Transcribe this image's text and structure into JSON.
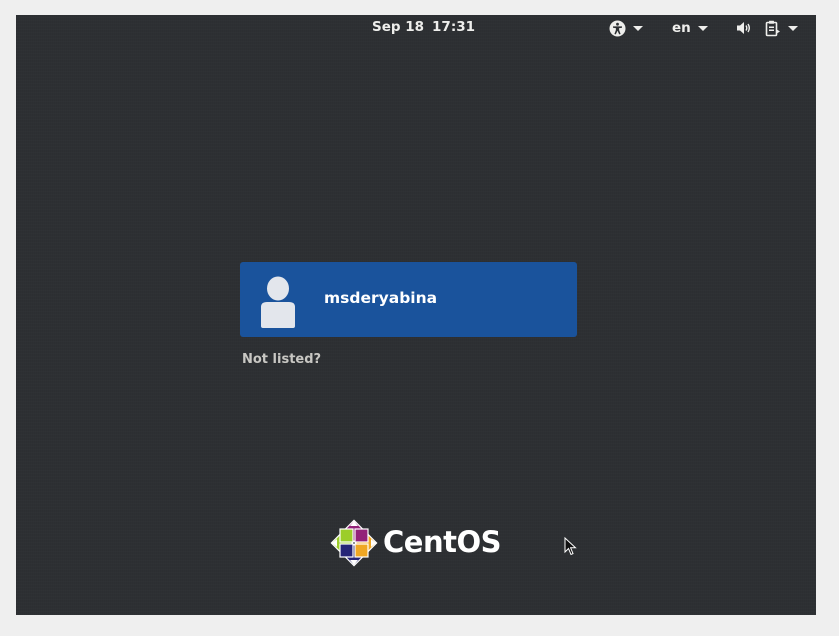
{
  "topbar": {
    "date": "Sep 18",
    "time": "17:31",
    "language": "en",
    "icons": {
      "accessibility": "accessibility-icon",
      "volume": "volume-icon",
      "power_menu": "clipboard-power-icon"
    }
  },
  "users": [
    {
      "name": "msderyabina",
      "avatar_icon": "user-avatar-icon"
    }
  ],
  "not_listed": "Not listed?",
  "logo": {
    "text": "CentOS",
    "icon": "centos-logo-icon"
  },
  "colors": {
    "background": "#2d3033",
    "user_card": "#1a539c",
    "topbar_text": "#eeeeec"
  }
}
